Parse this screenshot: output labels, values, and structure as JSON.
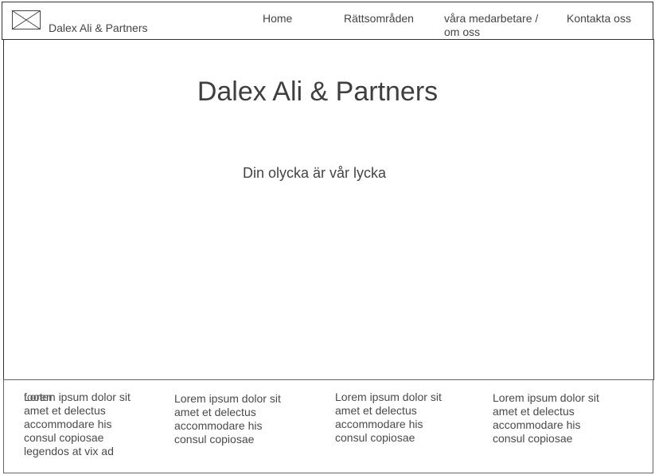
{
  "header": {
    "brand": "Dalex Ali & Partners",
    "logo_icon": "image-placeholder-icon",
    "nav": {
      "home": "Home",
      "areas": "Rättsområden",
      "staff": "våra medarbetare / om oss",
      "contact": "Kontakta oss"
    }
  },
  "hero": {
    "title": "Dalex Ali & Partners",
    "tagline": "Din olycka är vår lycka"
  },
  "footer": {
    "col1_overlap": "footer",
    "col1": "Lorem ipsum dolor sit amet et delectus accommodare his consul copiosae legendos at vix ad",
    "col2": "Lorem ipsum dolor sit amet et delectus accommodare his consul copiosae",
    "col3": "Lorem ipsum dolor sit amet et delectus accommodare his consul copiosae",
    "col4": "Lorem ipsum dolor sit amet et delectus accommodare his consul copiosae"
  }
}
